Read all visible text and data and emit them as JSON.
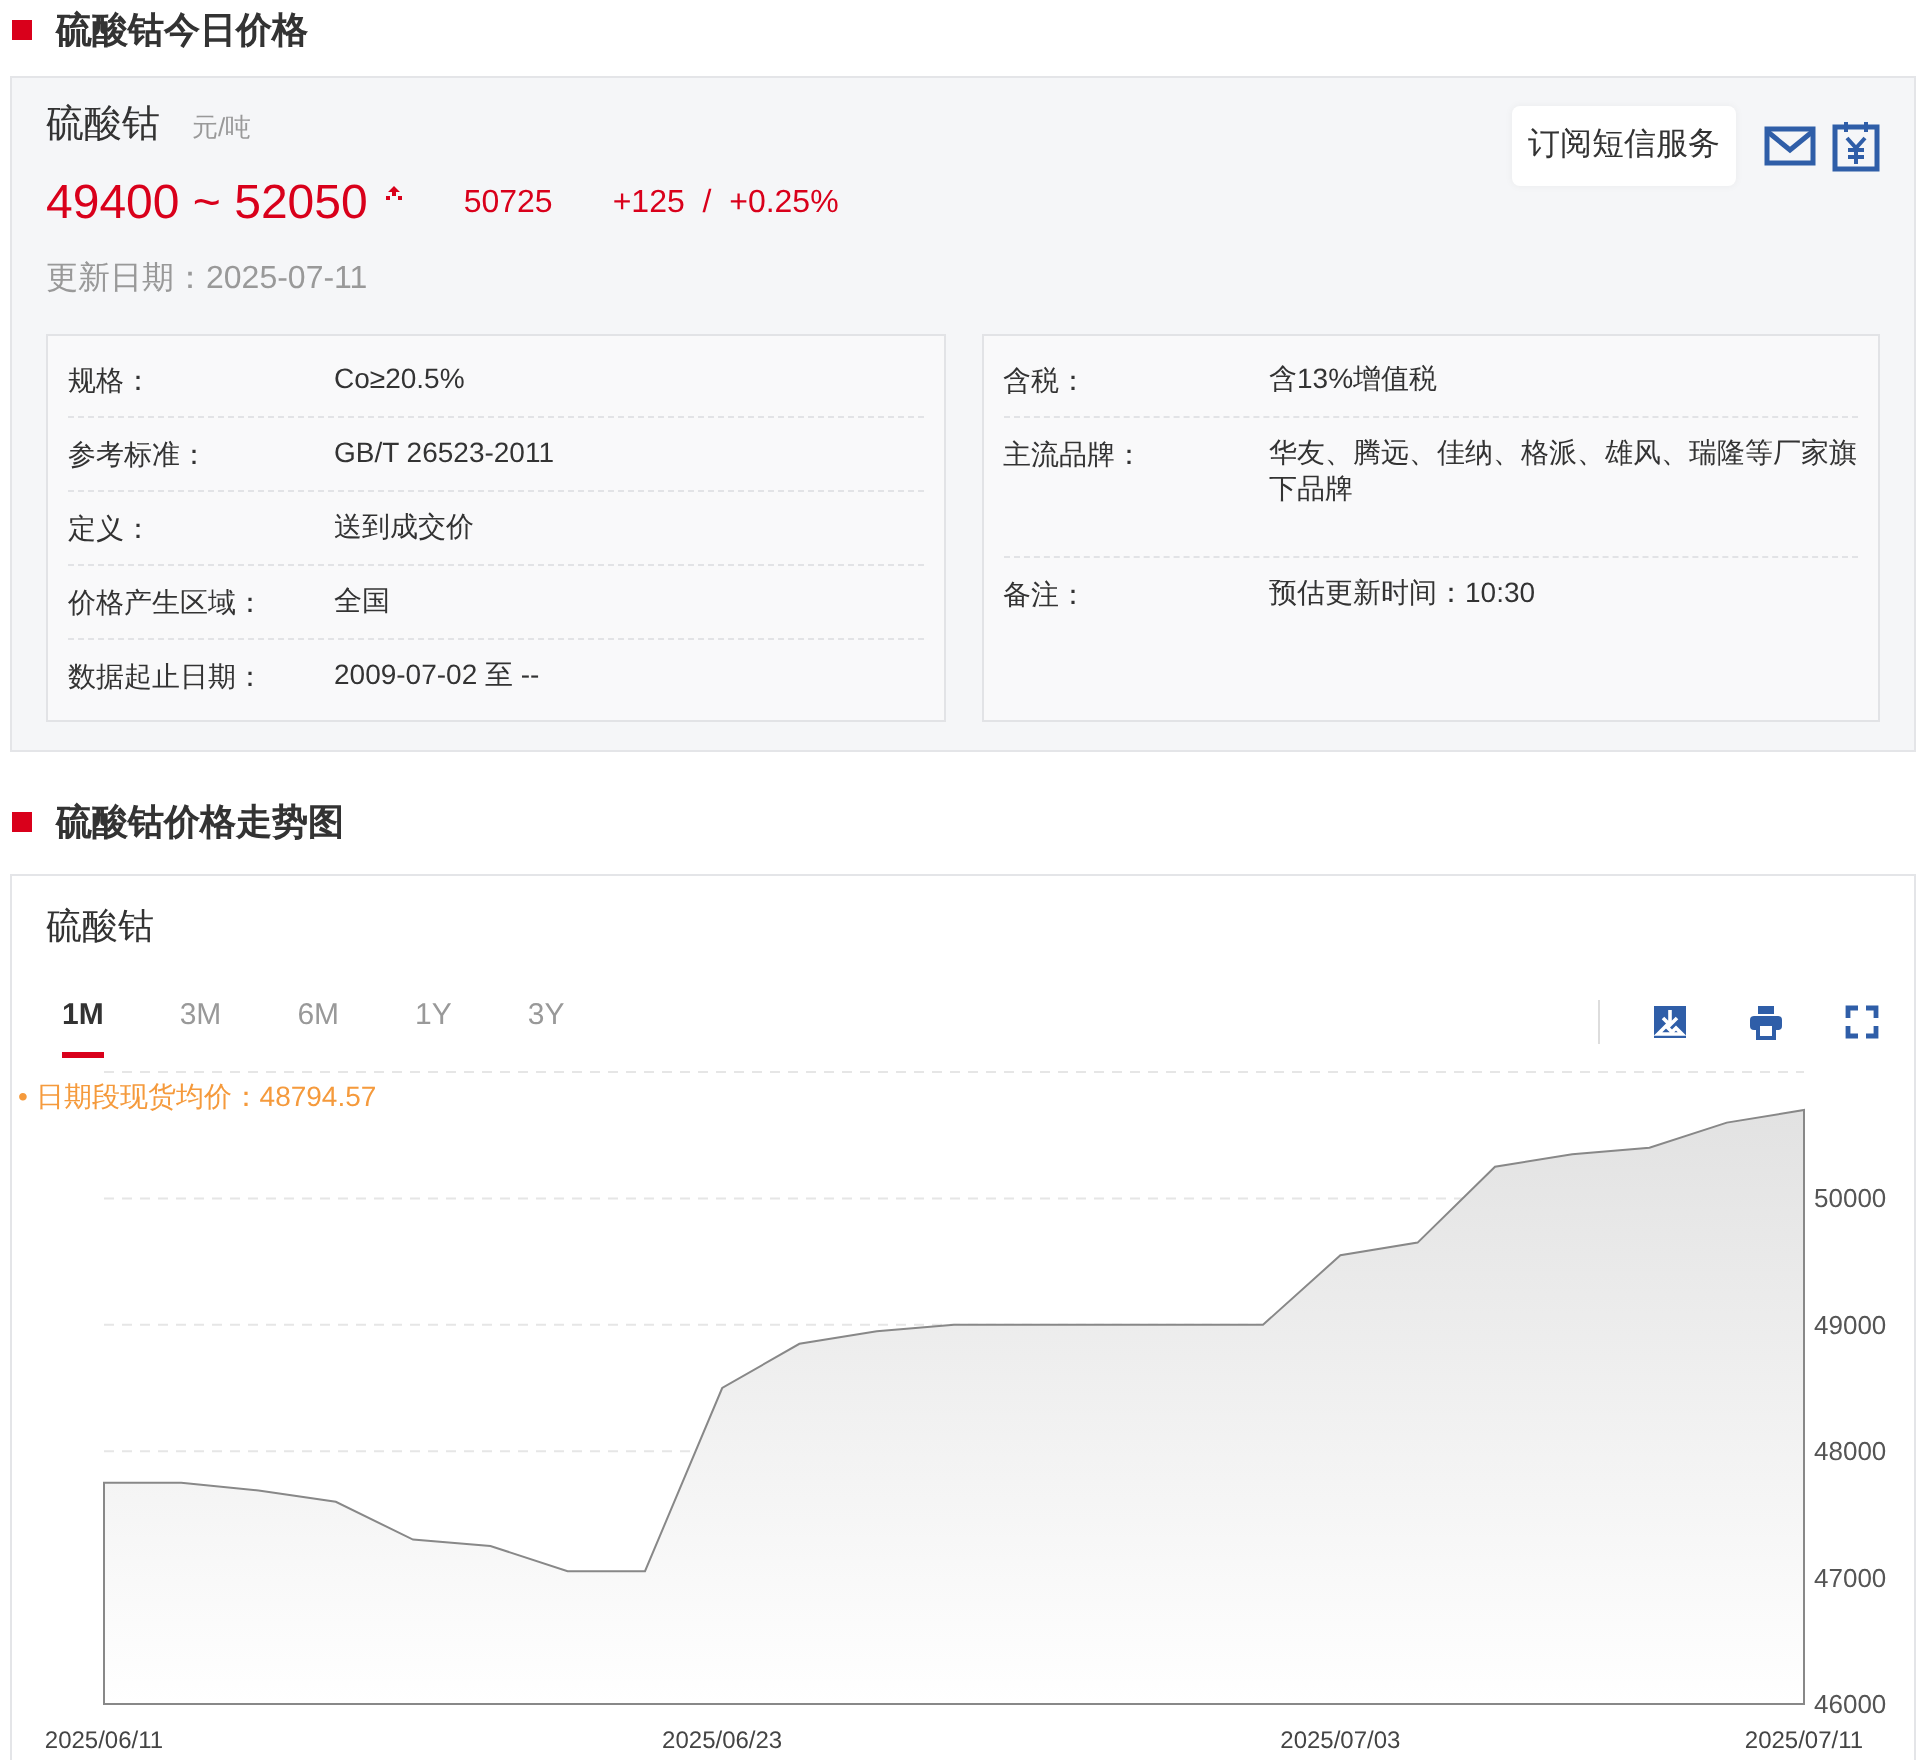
{
  "today_section": {
    "title": "硫酸钴今日价格"
  },
  "product": {
    "name": "硫酸钴",
    "unit": "元/吨",
    "price_range": "49400 ~ 52050",
    "rising": true,
    "average": "50725",
    "change": "+125  /  +0.25%",
    "updated": "更新日期：2025-07-11"
  },
  "subscribe": {
    "label": "订阅短信服务"
  },
  "specs_left": [
    {
      "label": "规格：",
      "value": "Co≥20.5%"
    },
    {
      "label": "参考标准：",
      "value": "GB/T 26523-2011"
    },
    {
      "label": "定义：",
      "value": "送到成交价"
    },
    {
      "label": "价格产生区域：",
      "value": "全国"
    },
    {
      "label": "数据起止日期：",
      "value": "2009-07-02 至 --"
    }
  ],
  "specs_right": [
    {
      "label": "含税：",
      "value": "含13%增值税"
    },
    {
      "label": "主流品牌：",
      "value": "华友、腾远、佳纳、格派、雄风、瑞隆等厂家旗下品牌"
    },
    {
      "label": "备注：",
      "value": "预估更新时间：10:30"
    }
  ],
  "trend_section": {
    "title": "硫酸钴价格走势图"
  },
  "chart_card": {
    "title": "硫酸钴",
    "ranges": [
      {
        "label": "1M",
        "selected": true
      },
      {
        "label": "3M",
        "selected": false
      },
      {
        "label": "6M",
        "selected": false
      },
      {
        "label": "1Y",
        "selected": false
      },
      {
        "label": "3Y",
        "selected": false
      }
    ],
    "average_label": "• 日期段现货均价：48794.57",
    "chart_data": {
      "type": "area",
      "categories": [
        "2025/06/11",
        null,
        null,
        null,
        null,
        null,
        null,
        null,
        "2025/06/23",
        null,
        null,
        null,
        null,
        null,
        null,
        null,
        "2025/07/03",
        null,
        null,
        null,
        null,
        null,
        "2025/07/11"
      ],
      "grid": true,
      "series": [
        {
          "color": "#888888",
          "values": [
            47750,
            47750,
            47690,
            47600,
            47300,
            47250,
            47050,
            47050,
            48500,
            48850,
            48950,
            49000,
            49000,
            49000,
            49000,
            49000,
            49550,
            49650,
            50250,
            50350,
            50400,
            50600,
            50700
          ]
        }
      ],
      "ylim": [
        46000,
        51000
      ],
      "yticks": [
        46000,
        47000,
        48000,
        49000,
        50000
      ]
    }
  }
}
